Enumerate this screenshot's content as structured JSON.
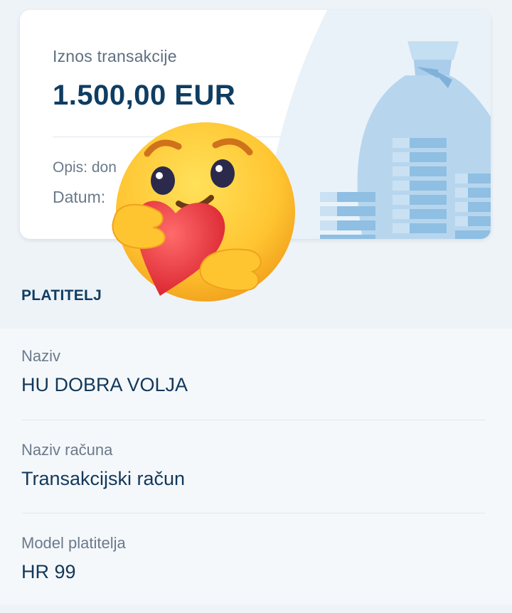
{
  "transaction": {
    "amount_label": "Iznos transakcije",
    "amount_value": "1.500,00 EUR",
    "description": "Opis: don",
    "date": "Datum:"
  },
  "payer_section": {
    "title": "PLATITELJ",
    "fields": [
      {
        "label": "Naziv",
        "value": "HU DOBRA VOLJA"
      },
      {
        "label": "Naziv računa",
        "value": "Transakcijski račun"
      },
      {
        "label": "Model platitelja",
        "value": "HR 99"
      }
    ]
  },
  "icons": {
    "background_illustration": "money-bag-with-coins-icon",
    "overlay_emoji": "care-emoji-icon"
  },
  "colors": {
    "primary_text": "#0f3d62",
    "secondary_text": "#6a7a8b",
    "illustration_blue": "#a9cdea"
  }
}
